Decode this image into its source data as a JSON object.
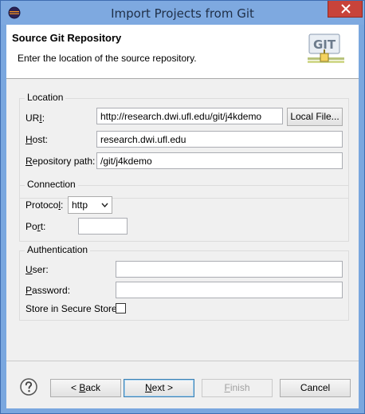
{
  "window": {
    "title": "Import Projects from Git"
  },
  "banner": {
    "title": "Source Git Repository",
    "description": "Enter the location of the source repository.",
    "icon_text": "GIT"
  },
  "location": {
    "legend": "Location",
    "uri_label_prefix": "UR",
    "uri_label_mnemonic": "I",
    "uri_label_suffix": ":",
    "uri_value": "http://research.dwi.ufl.edu/git/j4kdemo",
    "local_file_label": "Local File...",
    "host_label_mnemonic": "H",
    "host_label_rest": "ost:",
    "host_value": "research.dwi.ufl.edu",
    "path_label_mnemonic": "R",
    "path_label_rest": "epository path:",
    "path_value": "/git/j4kdemo"
  },
  "connection": {
    "legend": "Connection",
    "protocol_label_prefix": "Protoco",
    "protocol_label_mnemonic": "l",
    "protocol_label_suffix": ":",
    "protocol_value": "http",
    "port_label_prefix": "Po",
    "port_label_mnemonic": "r",
    "port_label_suffix": "t:",
    "port_value": ""
  },
  "authentication": {
    "legend": "Authentication",
    "user_label_mnemonic": "U",
    "user_label_rest": "ser:",
    "user_value": "",
    "password_label_mnemonic": "P",
    "password_label_rest": "assword:",
    "password_value": "",
    "secure_store_label": "Store in Secure Store",
    "secure_store_checked": false
  },
  "buttons": {
    "back_prefix": "< ",
    "back_mnemonic": "B",
    "back_rest": "ack",
    "next_mnemonic": "N",
    "next_rest": "ext >",
    "finish_mnemonic": "F",
    "finish_rest": "inish",
    "cancel": "Cancel"
  },
  "icons": {
    "app": "eclipse-icon",
    "close": "close-icon",
    "help": "help-icon",
    "banner": "git-repository-icon",
    "dropdown": "chevron-down-icon"
  },
  "colors": {
    "titlebar": "#7ea9e0",
    "close_button": "#c8433a",
    "default_button_border": "#3c7fb1"
  }
}
